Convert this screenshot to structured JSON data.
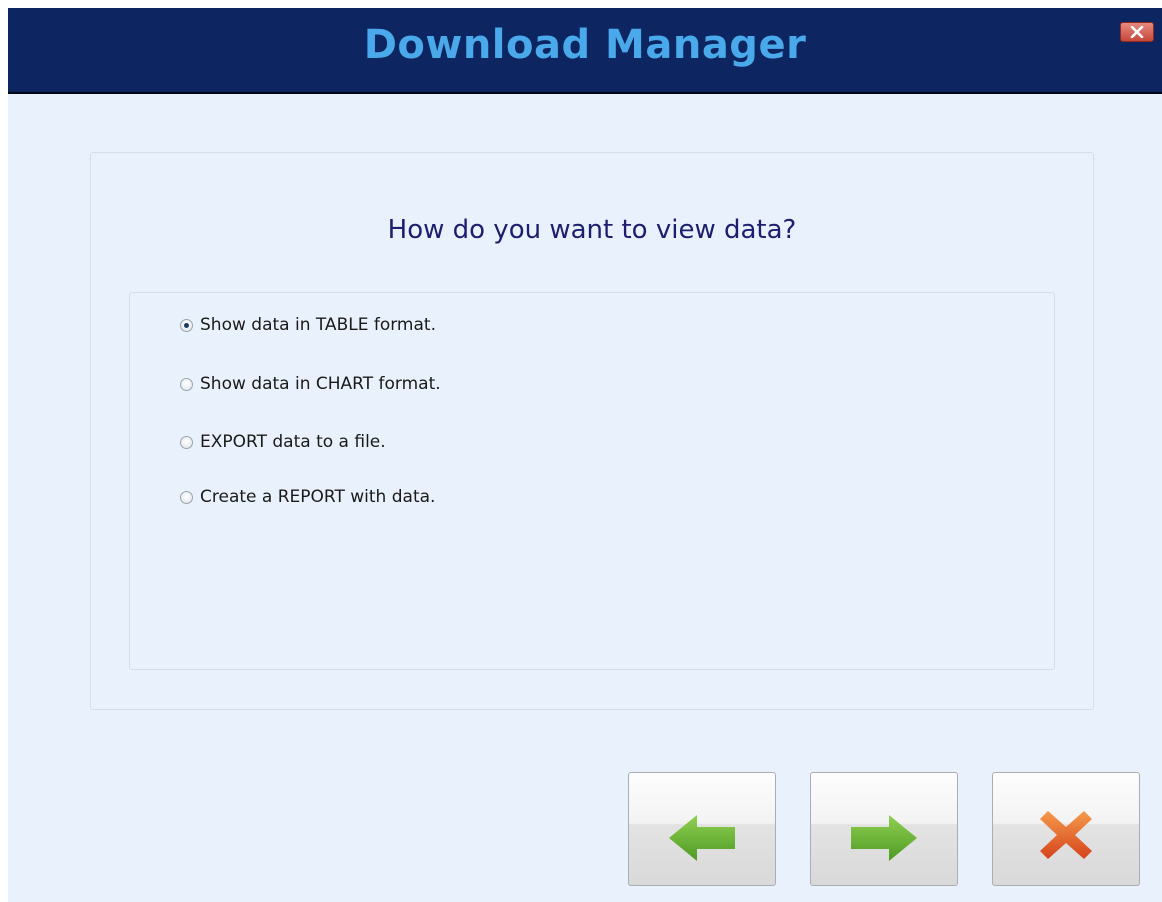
{
  "window": {
    "title": "Download Manager"
  },
  "titlebar": {
    "close_icon": "close-x-icon"
  },
  "prompt": {
    "question": "How do you want to view data?"
  },
  "options": [
    {
      "label": "Show data in TABLE format.",
      "selected": true
    },
    {
      "label": "Show data in CHART format.",
      "selected": false
    },
    {
      "label": "EXPORT data to a file.",
      "selected": false
    },
    {
      "label": "Create a REPORT with data.",
      "selected": false
    }
  ],
  "footer": {
    "back_icon": "arrow-left-icon",
    "next_icon": "arrow-right-icon",
    "cancel_icon": "cancel-x-icon"
  },
  "colors": {
    "titlebar": "#0d2560",
    "title_text": "#4aa9ea",
    "background": "#e9f2fc",
    "arrow_green": "#6fb43a",
    "cancel_orange": "#e2612c"
  }
}
